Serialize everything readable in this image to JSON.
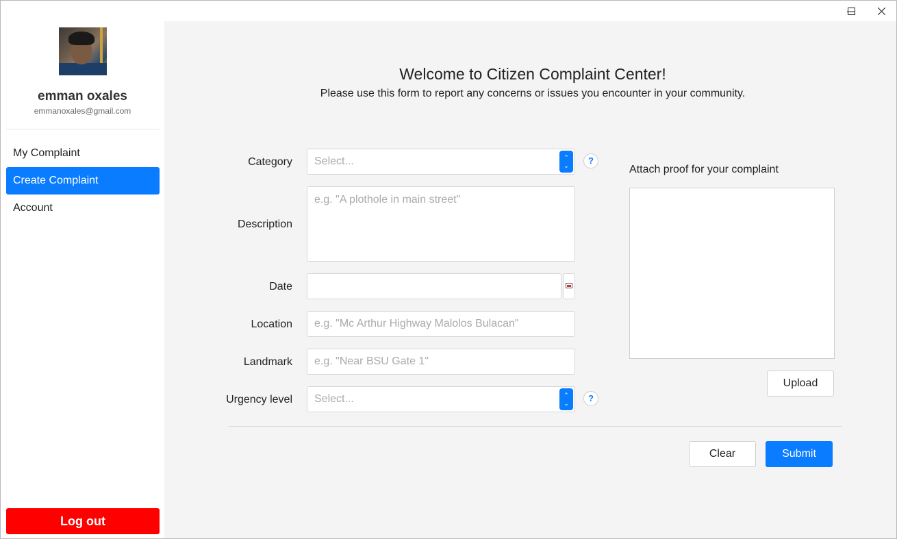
{
  "window": {
    "controls": {
      "minimize": "—",
      "maximize": "☐",
      "close": "✕"
    }
  },
  "sidebar": {
    "user": {
      "name": "emman oxales",
      "email": "emmanoxales@gmail.com"
    },
    "nav": [
      {
        "label": "My Complaint",
        "active": false
      },
      {
        "label": "Create Complaint",
        "active": true
      },
      {
        "label": "Account",
        "active": false
      }
    ],
    "logout_label": "Log out"
  },
  "main": {
    "title": "Welcome to Citizen Complaint Center!",
    "subtitle": "Please use this form to report any concerns or issues you encounter in your community.",
    "form": {
      "category": {
        "label": "Category",
        "placeholder": "Select..."
      },
      "description": {
        "label": "Description",
        "placeholder": "e.g. \"A plothole in main street\""
      },
      "date": {
        "label": "Date",
        "value": ""
      },
      "location": {
        "label": "Location",
        "placeholder": "e.g. \"Mc Arthur Highway Malolos Bulacan\""
      },
      "landmark": {
        "label": "Landmark",
        "placeholder": "e.g. \"Near BSU Gate 1\""
      },
      "urgency": {
        "label": "Urgency level",
        "placeholder": "Select..."
      },
      "help_glyph": "?"
    },
    "attach": {
      "label": "Attach proof for your complaint",
      "upload_label": "Upload"
    },
    "actions": {
      "clear_label": "Clear",
      "submit_label": "Submit"
    }
  },
  "colors": {
    "accent": "#0a7cff",
    "danger": "#ff0000",
    "background": "#f4f4f4"
  }
}
